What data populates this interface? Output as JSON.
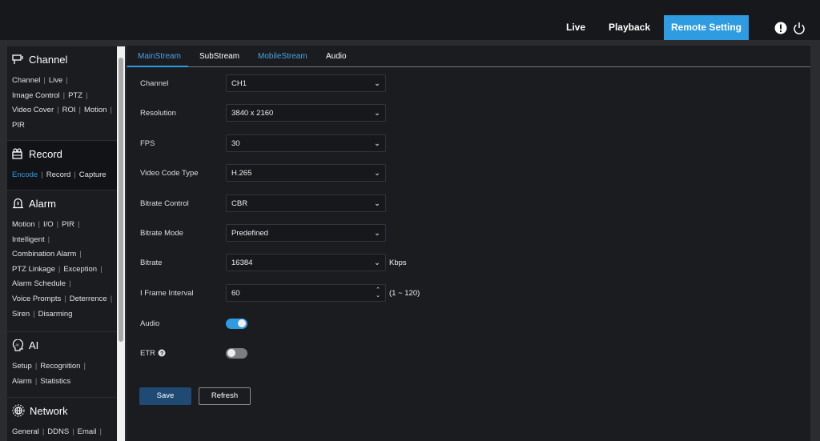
{
  "topnav": {
    "items": [
      "Live",
      "Playback",
      "Remote Setting"
    ],
    "active": "Remote Setting"
  },
  "sidebar": {
    "channel": {
      "title": "Channel",
      "links": [
        "Channel",
        "Live",
        "Image Control",
        "PTZ",
        "Video Cover",
        "ROI",
        "Motion",
        "PIR"
      ]
    },
    "record": {
      "title": "Record",
      "links": [
        "Encode",
        "Record",
        "Capture"
      ],
      "active": "Encode"
    },
    "alarm": {
      "title": "Alarm",
      "links": [
        "Motion",
        "I/O",
        "PIR",
        "Intelligent",
        "Combination Alarm",
        "PTZ Linkage",
        "Exception",
        "Alarm Schedule",
        "Voice Prompts",
        "Deterrence",
        "Siren",
        "Disarming"
      ]
    },
    "ai": {
      "title": "AI",
      "links": [
        "Setup",
        "Recognition",
        "Alarm",
        "Statistics"
      ]
    },
    "network": {
      "title": "Network",
      "links": [
        "General",
        "DDNS",
        "Email"
      ]
    }
  },
  "tabs": [
    "MainStream",
    "SubStream",
    "MobileStream",
    "Audio"
  ],
  "form": {
    "channel": {
      "label": "Channel",
      "value": "CH1"
    },
    "resolution": {
      "label": "Resolution",
      "value": "3840 x 2160"
    },
    "fps": {
      "label": "FPS",
      "value": "30"
    },
    "codec": {
      "label": "Video Code Type",
      "value": "H.265"
    },
    "bitrate_control": {
      "label": "Bitrate Control",
      "value": "CBR"
    },
    "bitrate_mode": {
      "label": "Bitrate Mode",
      "value": "Predefined"
    },
    "bitrate": {
      "label": "Bitrate",
      "value": "16384",
      "unit": "Kbps"
    },
    "iframe": {
      "label": "I Frame Interval",
      "value": "60",
      "range": "(1 ~ 120)"
    },
    "audio": {
      "label": "Audio",
      "on": true
    },
    "etr": {
      "label": "ETR",
      "on": false
    }
  },
  "buttons": {
    "save": "Save",
    "refresh": "Refresh"
  },
  "colors": {
    "accent": "#2f9be0",
    "save": "#1f4a73"
  }
}
